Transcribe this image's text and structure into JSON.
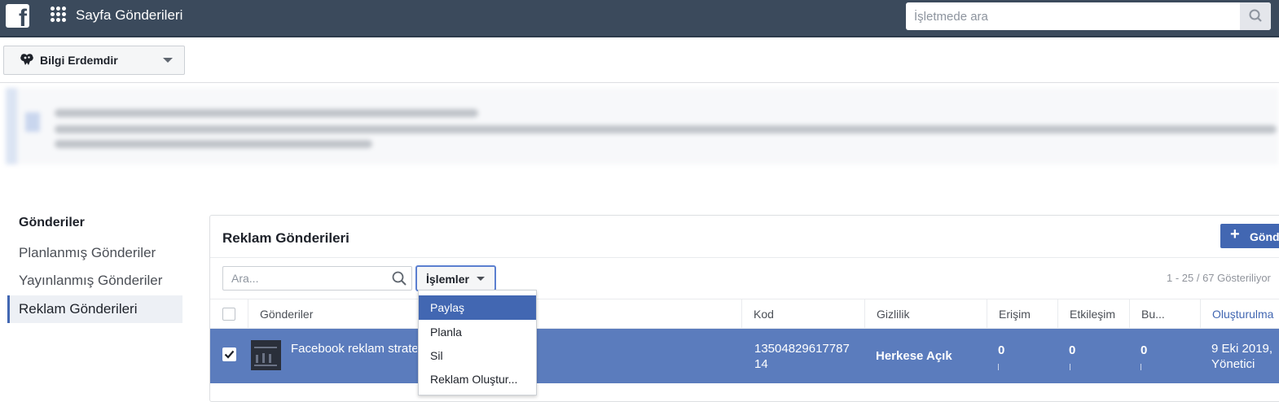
{
  "topbar": {
    "logo": "f",
    "app_title": "Sayfa Gönderileri",
    "search_placeholder": "İşletmede ara"
  },
  "page_selector": {
    "name": "Bilgi Erdemdir"
  },
  "sidebar": {
    "heading": "Gönderiler",
    "items": [
      {
        "label": "Planlanmış Gönderiler"
      },
      {
        "label": "Yayınlanmış Gönderiler"
      },
      {
        "label": "Reklam Gönderileri"
      }
    ]
  },
  "panel": {
    "title": "Reklam Gönderileri",
    "new_button_label": "Gönd",
    "search_placeholder": "Ara...",
    "actions_label": "İşlemler",
    "paging": "1 - 25 / 67 Gösteriliyor"
  },
  "table": {
    "columns": [
      "Gönderiler",
      "Kod",
      "Gizlilik",
      "Erişim",
      "Etkileşim",
      "Bu...",
      "Oluşturulma"
    ],
    "rows": [
      {
        "post": "Facebook reklam strate",
        "code_line1": "13504829617787",
        "code_line2": "14",
        "privacy": "Herkese Açık",
        "reach": "0",
        "engagement": "0",
        "bu": "0",
        "created_line1": "9 Eki 2019,",
        "created_line2": "Yönetici"
      }
    ]
  },
  "dropdown": {
    "items": [
      "Paylaş",
      "Planla",
      "Sil",
      "Reklam Oluştur..."
    ]
  },
  "colors": {
    "topbar": "#3b4a5c",
    "accent": "#4267b2",
    "selected_row": "#5b7cbd"
  }
}
